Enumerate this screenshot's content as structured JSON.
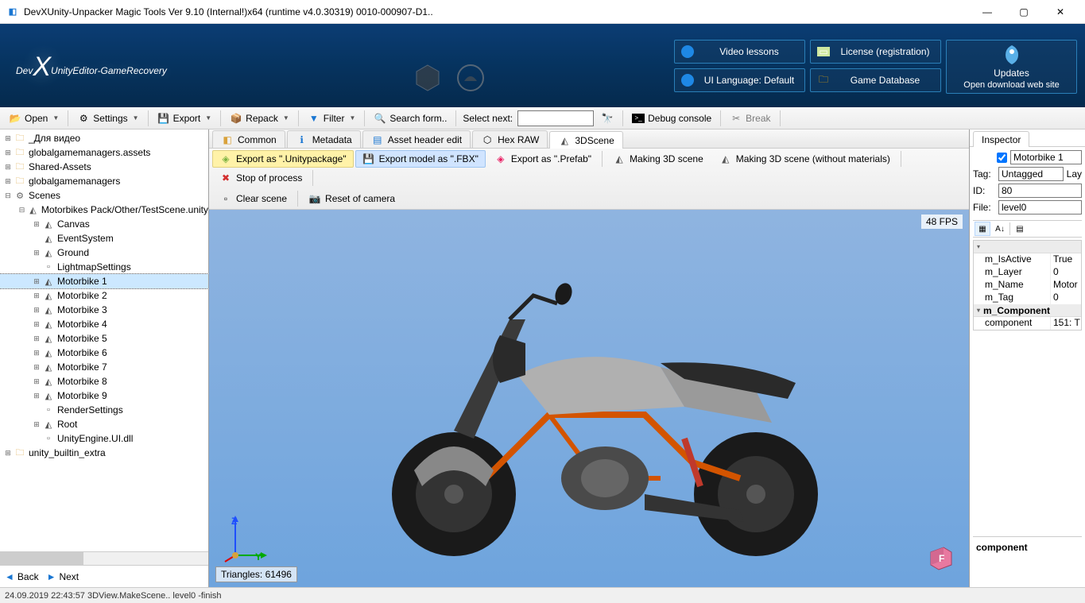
{
  "window": {
    "title": "DevXUnity-Unpacker Magic Tools Ver 9.10 (Internal!)x64 (runtime v4.0.30319) 0010-000907-D1.."
  },
  "banner": {
    "logo_pre": "Dev",
    "logo_x": "X",
    "logo_post": "UnityEditor-GameRecovery",
    "btn_video": "Video lessons",
    "btn_lang": "UI Language: Default",
    "btn_license": "License (registration)",
    "btn_db": "Game Database",
    "btn_updates": "Updates",
    "btn_updates_sub": "Open download web site"
  },
  "toolbar": {
    "open": "Open",
    "settings": "Settings",
    "export": "Export",
    "repack": "Repack",
    "filter": "Filter",
    "search": "Search form..",
    "select_next": "Select next:",
    "debug": "Debug console",
    "break": "Break"
  },
  "tree": [
    {
      "d": 0,
      "tw": "+",
      "ic": "folder",
      "t": "_Для видео"
    },
    {
      "d": 0,
      "tw": "+",
      "ic": "folder",
      "t": "globalgamemanagers.assets"
    },
    {
      "d": 0,
      "tw": "+",
      "ic": "folder",
      "t": "Shared-Assets"
    },
    {
      "d": 0,
      "tw": "+",
      "ic": "folder",
      "t": "globalgamemanagers"
    },
    {
      "d": 0,
      "tw": "-",
      "ic": "scene",
      "t": "Scenes"
    },
    {
      "d": 1,
      "tw": "-",
      "ic": "unity",
      "t": "Motorbikes Pack/Other/TestScene.unity"
    },
    {
      "d": 2,
      "tw": "+",
      "ic": "unity",
      "t": "Canvas"
    },
    {
      "d": 2,
      "tw": "",
      "ic": "unity",
      "t": "EventSystem"
    },
    {
      "d": 2,
      "tw": "+",
      "ic": "unity",
      "t": "Ground"
    },
    {
      "d": 2,
      "tw": "",
      "ic": "doc",
      "t": "LightmapSettings"
    },
    {
      "d": 2,
      "tw": "+",
      "ic": "unity",
      "t": "Motorbike 1",
      "sel": true
    },
    {
      "d": 2,
      "tw": "+",
      "ic": "unity",
      "t": "Motorbike 2"
    },
    {
      "d": 2,
      "tw": "+",
      "ic": "unity",
      "t": "Motorbike 3"
    },
    {
      "d": 2,
      "tw": "+",
      "ic": "unity",
      "t": "Motorbike 4"
    },
    {
      "d": 2,
      "tw": "+",
      "ic": "unity",
      "t": "Motorbike 5"
    },
    {
      "d": 2,
      "tw": "+",
      "ic": "unity",
      "t": "Motorbike 6"
    },
    {
      "d": 2,
      "tw": "+",
      "ic": "unity",
      "t": "Motorbike 7"
    },
    {
      "d": 2,
      "tw": "+",
      "ic": "unity",
      "t": "Motorbike 8"
    },
    {
      "d": 2,
      "tw": "+",
      "ic": "unity",
      "t": "Motorbike 9"
    },
    {
      "d": 2,
      "tw": "",
      "ic": "doc",
      "t": "RenderSettings"
    },
    {
      "d": 2,
      "tw": "+",
      "ic": "unity",
      "t": "Root"
    },
    {
      "d": 2,
      "tw": "",
      "ic": "doc",
      "t": "UnityEngine.UI.dll"
    },
    {
      "d": 0,
      "tw": "+",
      "ic": "folder",
      "t": "unity_builtin_extra"
    }
  ],
  "nav": {
    "back": "Back",
    "next": "Next"
  },
  "tabs": {
    "common": "Common",
    "meta": "Metadata",
    "header": "Asset header edit",
    "hex": "Hex RAW",
    "scene": "3DScene"
  },
  "subtool": {
    "exp_unity": "Export as \".Unitypackage\"",
    "exp_fbx": "Export model as \".FBX\"",
    "exp_prefab": "Export as \".Prefab\"",
    "make3d": "Making 3D scene",
    "make3d_nomat": "Making 3D scene (without materials)",
    "stop": "Stop of process",
    "clear": "Clear scene",
    "reset_cam": "Reset of camera"
  },
  "viewport": {
    "fps": "48 FPS",
    "triangles": "Triangles: 61496",
    "axis_z": "Z",
    "axis_y": "Y"
  },
  "inspector": {
    "title": "Inspector",
    "name": "Motorbike 1",
    "tag_lbl": "Tag:",
    "tag": "Untagged",
    "lay_lbl": "Lay",
    "id_lbl": "ID:",
    "id": "80",
    "file_lbl": "File:",
    "file": "level0",
    "props": [
      {
        "k": "m_IsActive",
        "v": "True"
      },
      {
        "k": "m_Layer",
        "v": "0"
      },
      {
        "k": "m_Name",
        "v": "Motor"
      },
      {
        "k": "m_Tag",
        "v": "0"
      }
    ],
    "section": "m_Component",
    "comp_k": "component",
    "comp_v": "151: T",
    "bottom": "component"
  },
  "status": "24.09.2019 22:43:57 3DView.MakeScene.. level0 -finish"
}
